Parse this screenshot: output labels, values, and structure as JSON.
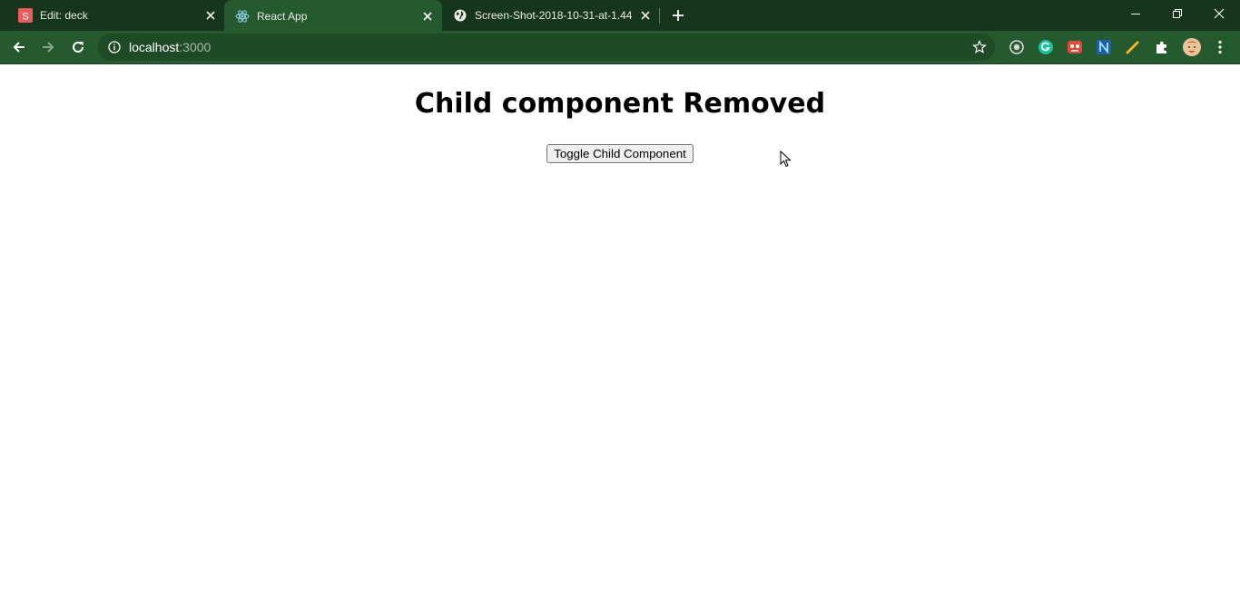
{
  "browser": {
    "tabs": [
      {
        "title": "Edit: deck",
        "favicon": "slides-s-icon",
        "favicon_letter": "S",
        "active": false
      },
      {
        "title": "React App",
        "favicon": "react-icon",
        "active": true
      },
      {
        "title": "Screen-Shot-2018-10-31-at-1.44",
        "favicon": "globe-icon",
        "active": false
      }
    ],
    "address": {
      "host": "localhost",
      "port": ":3000"
    },
    "extensions": [
      "circle-ext-icon",
      "grammarly-icon",
      "red-ext-icon",
      "n-ext-icon",
      "pencil-ext-icon",
      "puzzle-icon",
      "profile-avatar",
      "menu-icon"
    ],
    "colors": {
      "tabstrip": "#16351c",
      "toolbar": "#25592e",
      "omnibox": "#1e4a26"
    }
  },
  "page": {
    "heading": "Child component Removed",
    "toggle_button_label": "Toggle Child Component"
  }
}
